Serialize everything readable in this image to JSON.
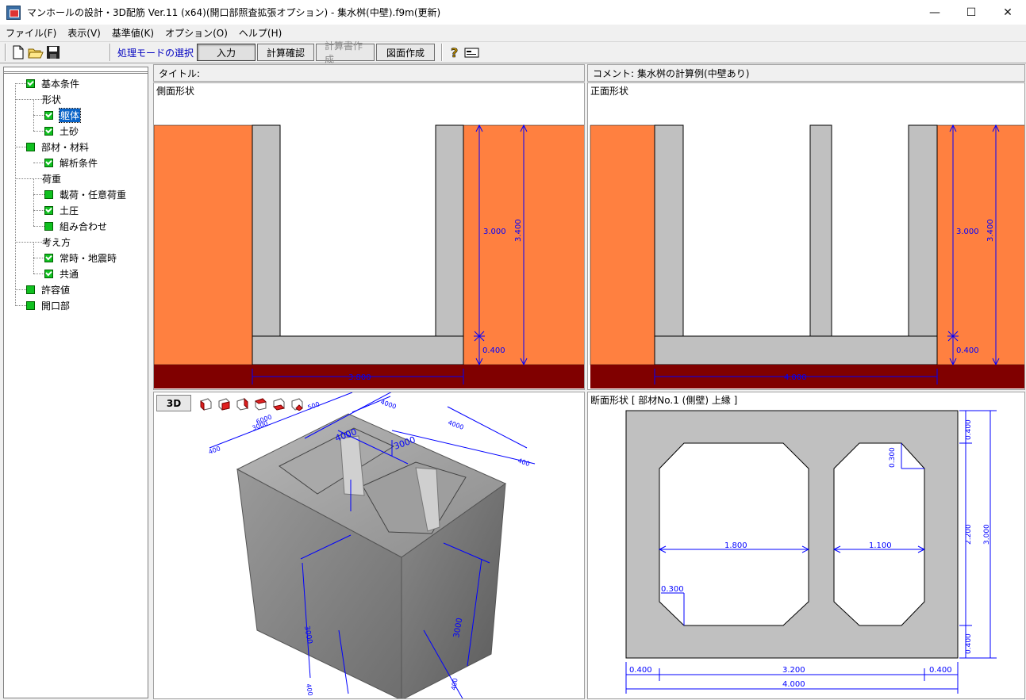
{
  "window": {
    "title": "マンホールの設計・3D配筋 Ver.11 (x64)(開口部照査拡張オプション) - 集水桝(中壁).f9m(更新)",
    "minimize": "—",
    "maximize": "☐",
    "close": "✕"
  },
  "menu": [
    "ファイル(F)",
    "表示(V)",
    "基準値(K)",
    "オプション(O)",
    "ヘルプ(H)"
  ],
  "toolbar": {
    "mode_label": "処理モードの選択",
    "buttons": [
      {
        "label": "入力",
        "state": "active"
      },
      {
        "label": "計算確認",
        "state": "normal"
      },
      {
        "label": "計算書作成",
        "state": "disabled"
      },
      {
        "label": "図面作成",
        "state": "normal"
      }
    ]
  },
  "tree": [
    {
      "label": "基本条件",
      "level": 0,
      "checkbox": true,
      "checked": true
    },
    {
      "label": "形状",
      "level": 1,
      "checkbox": false
    },
    {
      "label": "躯体",
      "level": 2,
      "checkbox": true,
      "checked": true,
      "selected": true
    },
    {
      "label": "土砂",
      "level": 2,
      "checkbox": true,
      "checked": true
    },
    {
      "label": "部材・材料",
      "level": 0,
      "checkbox": true,
      "checked": false
    },
    {
      "label": "解析条件",
      "level": 2,
      "checkbox": true,
      "checked": true
    },
    {
      "label": "荷重",
      "level": 1,
      "checkbox": false
    },
    {
      "label": "載荷・任意荷重",
      "level": 2,
      "checkbox": true,
      "checked": false
    },
    {
      "label": "土圧",
      "level": 2,
      "checkbox": true,
      "checked": true
    },
    {
      "label": "組み合わせ",
      "level": 2,
      "checkbox": true,
      "checked": false
    },
    {
      "label": "考え方",
      "level": 1,
      "checkbox": false
    },
    {
      "label": "常時・地震時",
      "level": 2,
      "checkbox": true,
      "checked": true
    },
    {
      "label": "共通",
      "level": 2,
      "checkbox": true,
      "checked": true
    },
    {
      "label": "許容値",
      "level": 0,
      "checkbox": true,
      "checked": false
    },
    {
      "label": "開口部",
      "level": 0,
      "checkbox": true,
      "checked": false
    }
  ],
  "headers": {
    "title_label": "タイトル:",
    "comment_label": "コメント:",
    "comment_value": "集水桝の計算例(中壁あり)"
  },
  "panels": {
    "side_view": {
      "caption": "側面形状",
      "dims": {
        "d1": "3.000",
        "d2": "3.400",
        "d3": "0.400",
        "d4": "3.800"
      }
    },
    "front_view": {
      "caption": "正面形状",
      "dims": {
        "d1": "3.000",
        "d2": "3.400",
        "d3": "0.400",
        "d4": "4.000"
      }
    },
    "view3d": {
      "button": "3D",
      "dims": {
        "a": "4000",
        "b": "3000",
        "c": "400",
        "d": "3000",
        "e": "400",
        "f": "3000",
        "g": "400",
        "h": "500",
        "i": "6000",
        "j": "4000",
        "k": "4000",
        "l": "400",
        "m": "400"
      }
    },
    "section": {
      "caption": "断面形状 [ 部材No.1 (側壁) 上縁 ]",
      "dims": {
        "left_width": "1.800",
        "right_width": "1.100",
        "chamfer_tr": "0.300",
        "chamfer_bl": "0.300",
        "v_top": "0.400",
        "v_mid": "2.200",
        "v_bot": "0.400",
        "v_total": "3.000",
        "h_left": "0.400",
        "h_mid": "3.200",
        "h_right": "0.400",
        "h_total": "4.000"
      }
    }
  },
  "colors": {
    "soil": "#ff8040",
    "concrete": "#c0c0c0",
    "base": "#800000",
    "dim": "#0000ff"
  }
}
